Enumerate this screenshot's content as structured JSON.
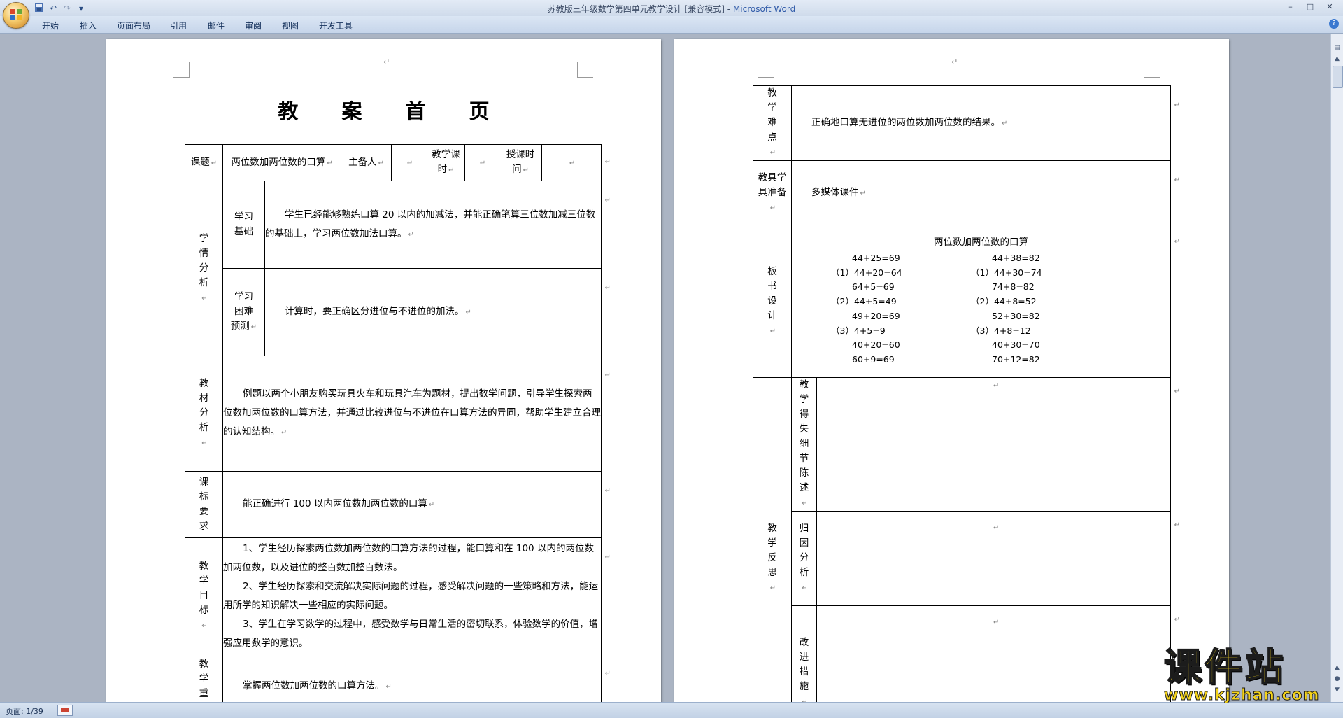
{
  "window": {
    "title_doc": "苏教版三年级数学第四单元教学设计 [兼容模式] - ",
    "title_app": "Microsoft Word",
    "controls": [
      "–",
      "□",
      "✕"
    ]
  },
  "quick_access": {
    "save_icon": "save-icon",
    "undo_icon": "undo-icon",
    "redo_icon": "redo-icon",
    "customize": "▾"
  },
  "ribbon_tabs": [
    "开始",
    "插入",
    "页面布局",
    "引用",
    "邮件",
    "审阅",
    "视图",
    "开发工具"
  ],
  "page1": {
    "heading": "教 案 首 页",
    "header_row": {
      "topic_label": "课题",
      "topic_value": "两位数加两位数的口算",
      "preparer_label": "主备人",
      "preparer_value": "",
      "hours_label": "教学课时",
      "hours_value": "",
      "time_label": "授课时间",
      "time_value": ""
    },
    "student_analysis": {
      "label": "学情分析",
      "basis_label": "学习基础",
      "basis_text": "学生已经能够熟练口算 20 以内的加减法，并能正确笔算三位数加减三位数的基础上，学习两位数加法口算。",
      "difficulty_label": "学习困难预测",
      "difficulty_text": "计算时，要正确区分进位与不进位的加法。"
    },
    "material_analysis": {
      "label": "教材分析",
      "text": "例题以两个小朋友购买玩具火车和玩具汽车为题材，提出数学问题，引导学生探索两位数加两位数的口算方法，并通过比较进位与不进位在口算方法的异同，帮助学生建立合理的认知结构。"
    },
    "standard": {
      "label": "课标要求",
      "text": "能正确进行 100 以内两位数加两位数的口算"
    },
    "goals": {
      "label": "教学目标",
      "items": [
        "1、学生经历探索两位数加两位数的口算方法的过程，能口算和在 100 以内的两位数加两位数，以及进位的整百数加整百数法。",
        "2、学生经历探索和交流解决实际问题的过程，感受解决问题的一些策略和方法，能运用所学的知识解决一些相应的实际问题。",
        "3、学生在学习数学的过程中，感受数学与日常生活的密切联系，体验数学的价值，增强应用数学的意识。"
      ]
    },
    "key_points": {
      "label": "教学重点",
      "text": "掌握两位数加两位数的口算方法。"
    }
  },
  "page2": {
    "difficulties": {
      "label": "教学难点",
      "text": "正确地口算无进位的两位数加两位数的结果。"
    },
    "tools": {
      "label": "教具学具准备",
      "text": "多媒体课件"
    },
    "board": {
      "label": "板书设计",
      "title": "两位数加两位数的口算",
      "left": [
        "44+25=69",
        "（1）44+20=64",
        "64+5=69",
        "（2）44+5=49",
        "49+20=69",
        "（3）4+5=9",
        "40+20=60",
        "60+9=69"
      ],
      "right": [
        "44+38=82",
        "（1）44+30=74",
        "74+8=82",
        "（2）44+8=52",
        "52+30=82",
        "（3）4+8=12",
        "40+30=70",
        "70+12=82"
      ]
    },
    "reflection": {
      "label": "教学反思",
      "detail_label": "教学得失细节陈述",
      "cause_label": "归因分析",
      "improve_label": "改进措施"
    }
  },
  "status_bar": {
    "page_info": "页面: 1/39"
  },
  "watermark": {
    "name": "课件站",
    "url": "www.kjzhan.com"
  }
}
